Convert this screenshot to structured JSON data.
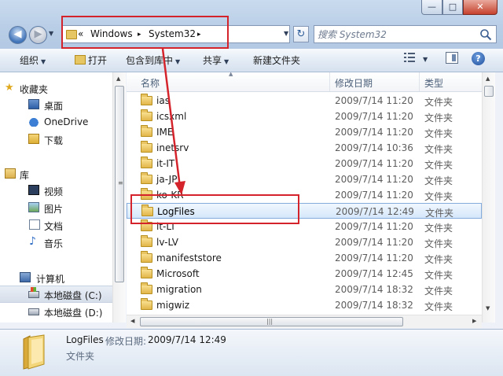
{
  "window": {
    "buttons": {
      "minimize": "—",
      "maximize": "□",
      "close": "✕"
    }
  },
  "address": {
    "overflow": "«",
    "crumbs": [
      "Windows",
      "System32"
    ],
    "separator": "▸"
  },
  "search": {
    "placeholder": "搜索 System32"
  },
  "toolbar": {
    "organize": "组织",
    "open": "打开",
    "include": "包含到库中",
    "share": "共享",
    "new_folder": "新建文件夹"
  },
  "nav": {
    "favorites": "收藏夹",
    "desktop": "桌面",
    "onedrive": "OneDrive",
    "downloads": "下载",
    "libraries": "库",
    "videos": "视频",
    "pictures": "图片",
    "documents": "文档",
    "music": "音乐",
    "computer": "计算机",
    "drive_c": "本地磁盘 (C:)",
    "drive_d": "本地磁盘 (D:)"
  },
  "columns": {
    "name": "名称",
    "date": "修改日期",
    "type": "类型"
  },
  "files": [
    {
      "name": "ias",
      "date": "2009/7/14 11:20",
      "type": "文件夹"
    },
    {
      "name": "icsxml",
      "date": "2009/7/14 11:20",
      "type": "文件夹"
    },
    {
      "name": "IME",
      "date": "2009/7/14 11:20",
      "type": "文件夹"
    },
    {
      "name": "inetsrv",
      "date": "2009/7/14 10:36",
      "type": "文件夹"
    },
    {
      "name": "it-IT",
      "date": "2009/7/14 11:20",
      "type": "文件夹"
    },
    {
      "name": "ja-JP",
      "date": "2009/7/14 11:20",
      "type": "文件夹"
    },
    {
      "name": "ko-KR",
      "date": "2009/7/14 11:20",
      "type": "文件夹"
    },
    {
      "name": "LogFiles",
      "date": "2009/7/14 12:49",
      "type": "文件夹"
    },
    {
      "name": "lt-LT",
      "date": "2009/7/14 11:20",
      "type": "文件夹"
    },
    {
      "name": "lv-LV",
      "date": "2009/7/14 11:20",
      "type": "文件夹"
    },
    {
      "name": "manifeststore",
      "date": "2009/7/14 11:20",
      "type": "文件夹"
    },
    {
      "name": "Microsoft",
      "date": "2009/7/14 12:45",
      "type": "文件夹"
    },
    {
      "name": "migration",
      "date": "2009/7/14 18:32",
      "type": "文件夹"
    },
    {
      "name": "migwiz",
      "date": "2009/7/14 18:32",
      "type": "文件夹"
    }
  ],
  "selected_index": 7,
  "details": {
    "name": "LogFiles",
    "date_label": "修改日期:",
    "date": "2009/7/14 12:49",
    "type": "文件夹"
  },
  "colors": {
    "annotation": "#d4232b",
    "selection": "#d5e7fb"
  }
}
